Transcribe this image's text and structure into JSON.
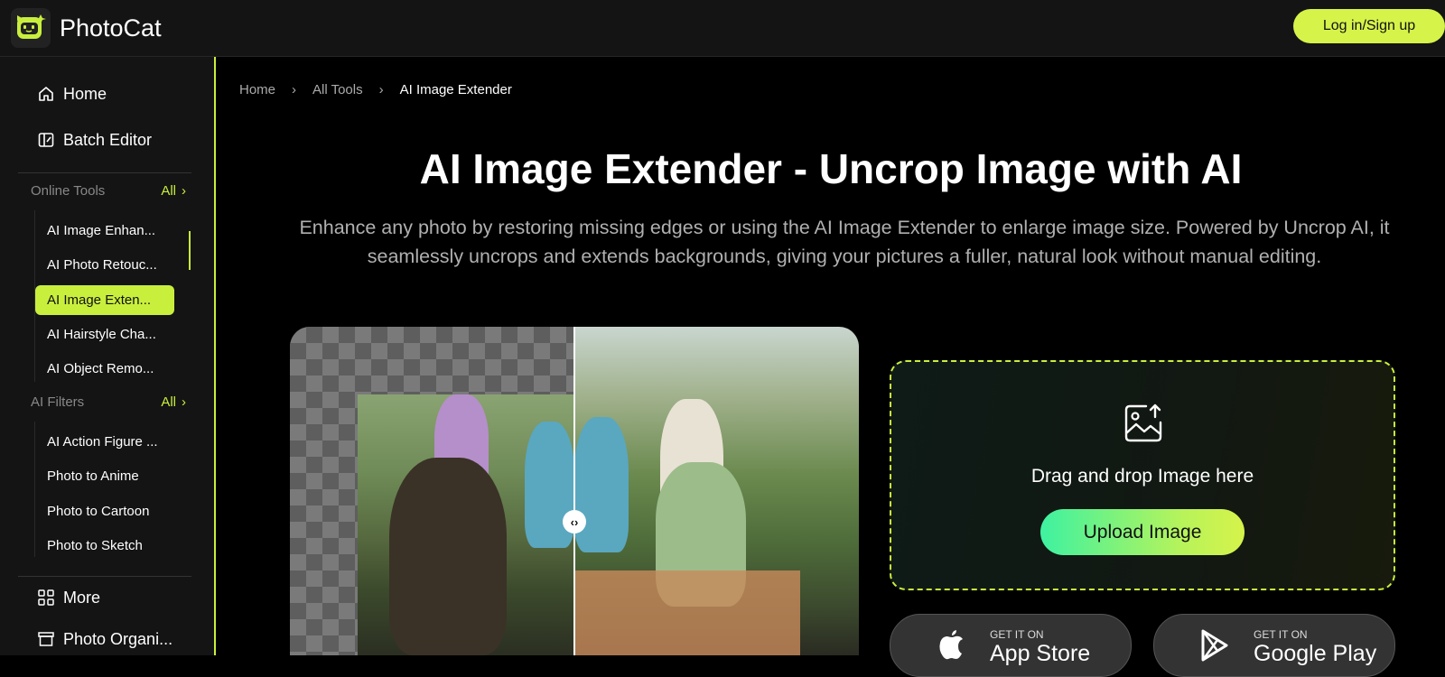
{
  "app": {
    "name": "PhotoCat"
  },
  "header": {
    "login_label": "Log in/Sign up"
  },
  "sidebar": {
    "home": "Home",
    "batch_editor": "Batch Editor",
    "online_tools": {
      "heading": "Online Tools",
      "all_label": "All",
      "items": [
        "AI Image Enhan...",
        "AI Photo Retouc...",
        "AI Image Exten...",
        "AI Hairstyle Cha...",
        "AI Object Remo..."
      ],
      "active_index": 2
    },
    "ai_filters": {
      "heading": "AI Filters",
      "all_label": "All",
      "items": [
        "AI Action Figure ...",
        "Photo to Anime",
        "Photo to Cartoon",
        "Photo to Sketch"
      ]
    },
    "more": "More",
    "photo_organizer": "Photo Organi..."
  },
  "breadcrumb": {
    "home": "Home",
    "all_tools": "All Tools",
    "current": "AI Image Extender"
  },
  "main": {
    "title": "AI Image Extender - Uncrop Image with AI",
    "description": "Enhance any photo by restoring missing edges or using the AI Image Extender to enlarge image size. Powered by Uncrop AI, it seamlessly uncrops and extends backgrounds, giving your pictures a fuller, natural look without manual editing."
  },
  "upload": {
    "drop_text": "Drag and drop Image here",
    "button_label": "Upload Image"
  },
  "stores": {
    "app_store": {
      "small": "GET IT ON",
      "big": "App Store"
    },
    "google_play": {
      "small": "GET IT ON",
      "big": "Google Play"
    }
  },
  "colors": {
    "accent": "#c9ef3d",
    "sidebar_bg": "#141414",
    "page_bg": "#000000"
  }
}
